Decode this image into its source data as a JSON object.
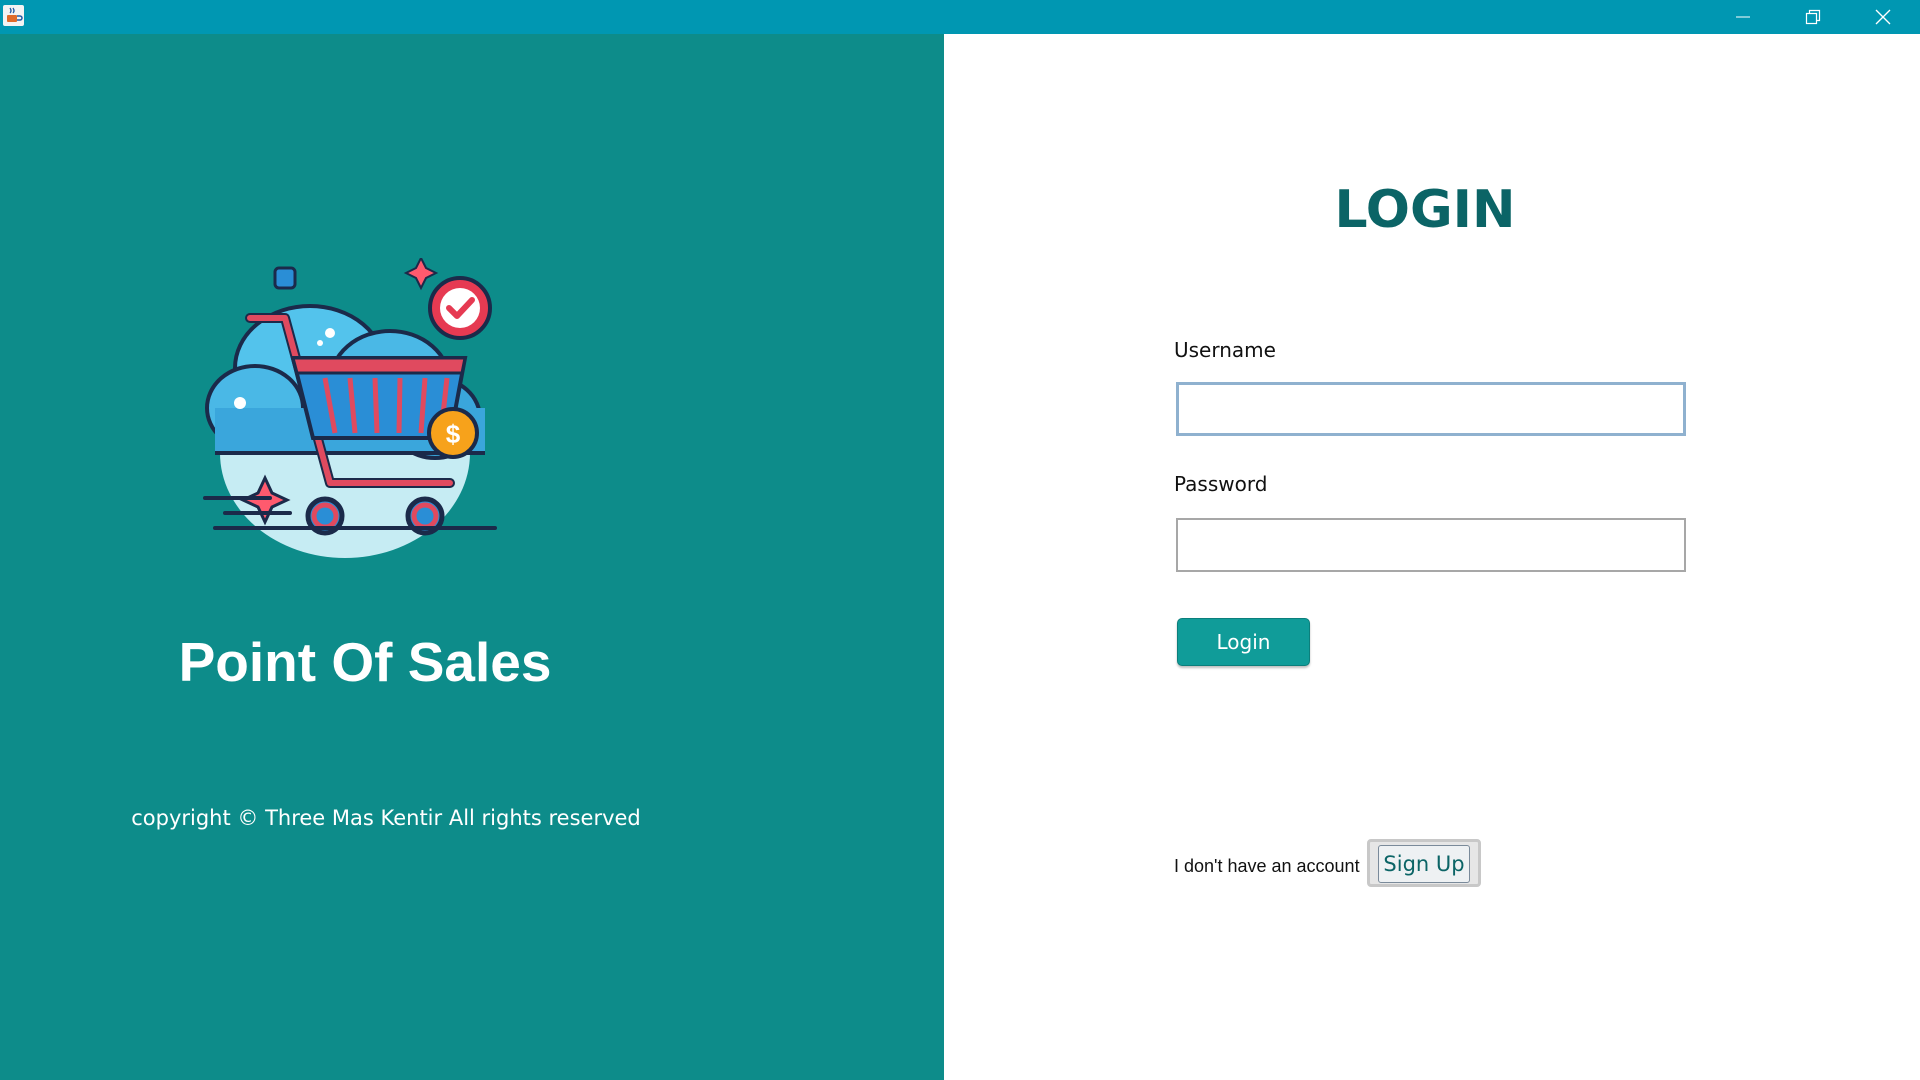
{
  "window": {
    "app_icon": "java-cup-icon",
    "controls": [
      "minimize-icon",
      "restore-icon",
      "close-icon"
    ],
    "titlebar_color": "#0097b2"
  },
  "brand": {
    "logo": "shopping-cart-cloud-icon",
    "title": "Point Of Sales",
    "copyright": "copyright © Three Mas Kentir All rights reserved",
    "panel_color": "#0d8c8a"
  },
  "login_form": {
    "heading": "LOGIN",
    "username_label": "Username",
    "username_value": "",
    "password_label": "Password",
    "password_value": "",
    "login_button": "Login",
    "no_account_text": "I don't have an account",
    "signup_button": "Sign Up",
    "accent_color": "#0b6466"
  }
}
